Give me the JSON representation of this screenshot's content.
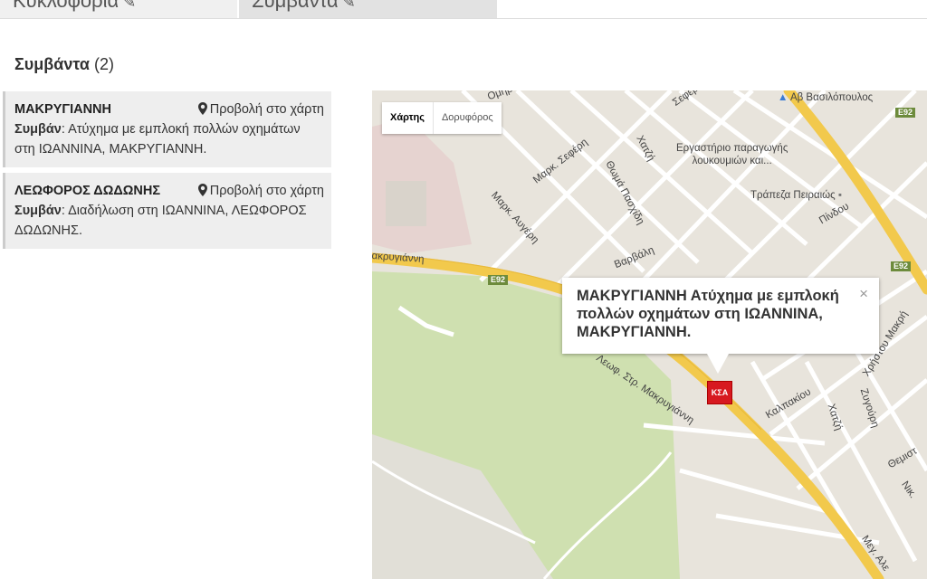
{
  "tabs": [
    {
      "label": "Κυκλοφορία",
      "icon": "pencil-icon"
    },
    {
      "label": "Συμβάντα",
      "icon": "pencil-icon"
    }
  ],
  "section": {
    "title": "Συμβάντα",
    "count": "(2)"
  },
  "events": [
    {
      "name": "ΜΑΚΡΥΓΙΑΝΝΗ",
      "link": "Προβολή στο χάρτη",
      "prefix": "Συμβάν",
      "desc": ": Ατύχημα με εμπλοκή πολλών οχημάτων στη ΙΩΑΝΝΙΝΑ, ΜΑΚΡΥΓΙΑΝΝΗ."
    },
    {
      "name": "ΛΕΩΦΟΡΟΣ ΔΩΔΩΝΗΣ",
      "link": "Προβολή στο χάρτη",
      "prefix": "Συμβάν",
      "desc": ": Διαδήλωση στη ΙΩΑΝΝΙΝΑ, ΛΕΩΦΟΡΟΣ ΔΩΔΩΝΗΣ."
    }
  ],
  "map": {
    "type_map": "Χάρτης",
    "type_satellite": "Δορυφόρος",
    "pois": {
      "vasilopoulos": "Αβ Βασιλόπουλος",
      "workshop_1": "Εργαστήριο παραγωγής",
      "workshop_2": "λουκουμιών και...",
      "bank": "Τράπεζα Πειραιώς"
    },
    "streets": {
      "makrygianni": "ακρυγιάννη",
      "sefer1": "Μαρκ. Σεφέρη",
      "avgeri": "Μαρκ. Αυγέρη",
      "pasxidi": "Θωμά Πασχίδη",
      "xatzi": "Χατζή",
      "varvali": "Βαρβάλη",
      "pindou": "Πίνδου",
      "xristou": "Χρήστου Μακρή",
      "zygouri": "Ζυγούρη",
      "xatzi2": "Χατζή",
      "kalpakiou": "Καλπακίου",
      "leof": "Λεωφ. Στρ. Μακρυγιάννη",
      "themistokleous": "Θεμιστ",
      "meg_alex": "Μεγ. Αλε",
      "nik": "Νικ.",
      "sefer2": "Σεφερ",
      "omir": "Ομήρ"
    },
    "road_tags": [
      "E92",
      "E92",
      "E92"
    ],
    "infowindow": "ΜΑΚΡΥΓΙΑΝΝΗ Ατύχημα με εμπλοκή πολλών οχημάτων στη ΙΩΑΝΝΙΝΑ, ΜΑΚΡΥΓΙΑΝΝΗ.",
    "close": "×",
    "marker": "ΚΣΑ"
  }
}
